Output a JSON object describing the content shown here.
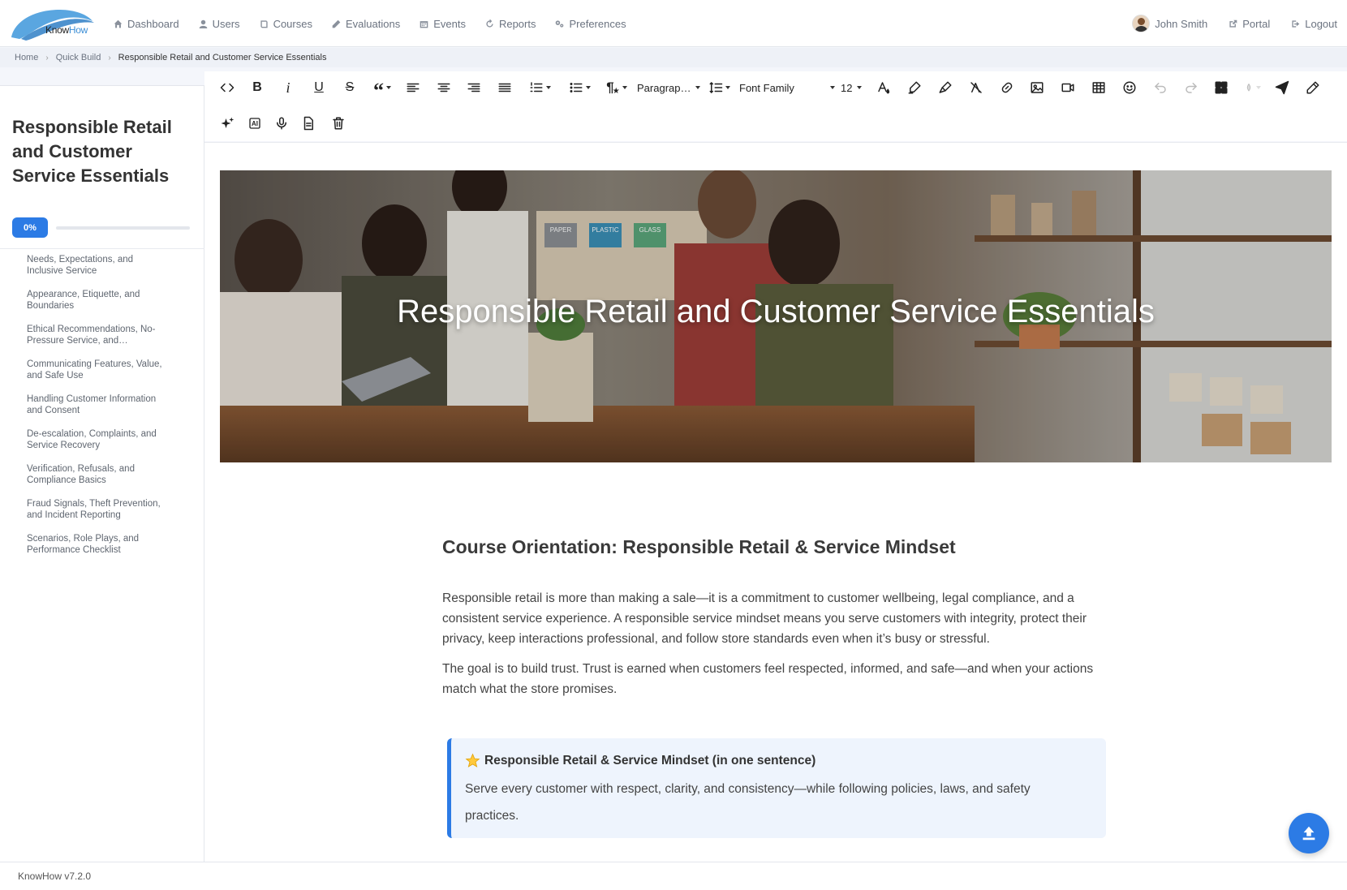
{
  "brand": {
    "logo_part1": "Know",
    "logo_part2": "How"
  },
  "nav": {
    "items": [
      {
        "label": "Dashboard",
        "icon": "home-icon"
      },
      {
        "label": "Users",
        "icon": "user-icon"
      },
      {
        "label": "Courses",
        "icon": "book-icon"
      },
      {
        "label": "Evaluations",
        "icon": "pencil-icon"
      },
      {
        "label": "Events",
        "icon": "calendar-icon"
      },
      {
        "label": "Reports",
        "icon": "refresh-icon"
      },
      {
        "label": "Preferences",
        "icon": "gears-icon"
      }
    ],
    "user_name": "John Smith",
    "portal_label": "Portal",
    "logout_label": "Logout"
  },
  "breadcrumb": {
    "home": "Home",
    "quick_build": "Quick Build",
    "current": "Responsible Retail and Customer Service Essentials"
  },
  "sidebar": {
    "course_title": "Responsible Retail and Customer Service Essentials",
    "progress_label": "0%",
    "progress_fraction": 0,
    "lessons": [
      "Needs, Expectations, and Inclusive Service",
      "Appearance, Etiquette, and Boundaries",
      "Ethical Recommendations, No-Pressure Service, and…",
      "Communicating Features, Value, and Safe Use",
      "Handling Customer Information and Consent",
      "De-escalation, Complaints, and Service Recovery",
      "Verification, Refusals, and Compliance Basics",
      "Fraud Signals, Theft Prevention, and Incident Reporting",
      "Scenarios, Role Plays, and Performance Checklist"
    ]
  },
  "toolbar": {
    "paragraph_select": "Paragrap…",
    "font_family_select": "Font Family",
    "font_size_select": "12",
    "italic_label": "i",
    "bold_label": "B",
    "underline_label": "U",
    "strike_label": "S",
    "ai_label": "AI"
  },
  "content": {
    "hero_title": "Responsible Retail and Customer Service Essentials",
    "hero_sign_labels": [
      "PAPER",
      "PLASTIC",
      "GLASS"
    ],
    "section_heading": "Course Orientation: Responsible Retail & Service Mindset",
    "paragraph1": "Responsible retail is more than making a sale—it is a commitment to customer wellbeing, legal compliance, and a consistent service experience. A responsible service mindset means you serve customers with integrity, protect their privacy, keep interactions professional, and follow store standards even when it’s busy or stressful.",
    "paragraph2": "The goal is to build trust. Trust is earned when customers feel respected, informed, and safe—and when your actions match what the store promises.",
    "callout_title": "Responsible Retail & Service Mindset (in one sentence)",
    "callout_body": "Serve every customer with respect, clarity, and consistency—while following policies, laws, and safety practices."
  },
  "footer": {
    "version": "KnowHow v7.2.0"
  },
  "colors": {
    "accent": "#2c7be5",
    "callout_bg": "#eef4fd"
  }
}
